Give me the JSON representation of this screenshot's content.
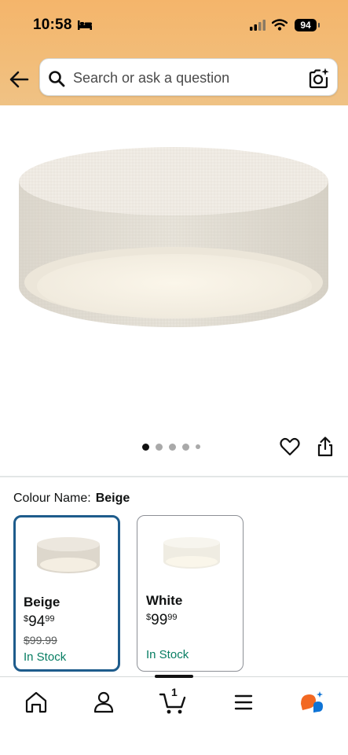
{
  "status_bar": {
    "time": "10:58",
    "battery": "94",
    "icons": [
      "bed-icon",
      "signal-icon",
      "wifi-icon",
      "battery-icon"
    ]
  },
  "header": {
    "back_icon": "arrow-left-icon",
    "search": {
      "placeholder": "Search or ask a question",
      "value": ""
    },
    "camera_icon": "camera-sparkle-icon"
  },
  "product": {
    "image": "fabric-drum-ceiling-light",
    "carousel": {
      "count": 5,
      "active_index": 0
    },
    "actions": [
      "heart-icon",
      "share-icon"
    ]
  },
  "variation": {
    "label": "Colour Name:",
    "selected": "Beige",
    "options": [
      {
        "name": "Beige",
        "currency": "$",
        "price_whole": "94",
        "price_fraction": "99",
        "list_price": "$99.99",
        "availability": "In Stock",
        "selected": true
      },
      {
        "name": "White",
        "currency": "$",
        "price_whole": "99",
        "price_fraction": "99",
        "list_price": "",
        "availability": "In Stock",
        "selected": false
      }
    ]
  },
  "bottom_nav": {
    "items": [
      "home-icon",
      "account-icon",
      "cart-icon",
      "menu-icon",
      "rufus-icon"
    ],
    "cart_count": "1",
    "colors": {
      "accent_orange": "#f26822",
      "accent_blue": "#0f74d6"
    }
  },
  "colors": {
    "header_bg": "#f2bd79",
    "selected_border": "#1e5c8c",
    "in_stock": "#067d62"
  }
}
